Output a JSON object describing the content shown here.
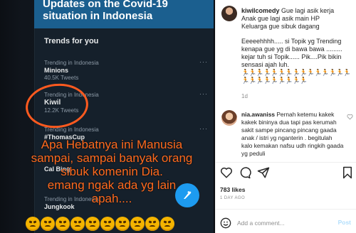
{
  "media": {
    "header_lines": [
      "Updates on the Covid-19",
      "situation in Indonesia"
    ],
    "trends_title": "Trends for you",
    "trends": [
      {
        "context": "Trending in Indonesia",
        "name": "Minions",
        "count": "40.5K Tweets"
      },
      {
        "context": "Trending in Indonesia",
        "name": "Kiwil",
        "count": "12.2K Tweets"
      },
      {
        "context": "Trending in Indonesia",
        "name": "#ThomasCup",
        "count": ""
      },
      {
        "context": "Trending in Indonesia",
        "name": "Cal Bing",
        "count": ""
      },
      {
        "context": "Trending in Indonesia",
        "name": "Jungkook",
        "count": ""
      }
    ],
    "overlay_lines": [
      "Apa Hebatnya ini Manusia",
      "sampai, sampai banyak orang",
      "sibuk komenin Dia.",
      "emang ngak ada yg lain",
      "apah...."
    ],
    "emoji_count": 10,
    "colors": {
      "overlay_text": "#ff6a1e",
      "circle": "#ff5a1f",
      "fab": "#1d9bf0"
    }
  },
  "post": {
    "username": "kiwilcomedy",
    "caption_lines": [
      "Gue lagi asik kerja",
      "Anak gue lagi asik main HP",
      "Keluarga gue sibuk dagang"
    ],
    "caption_body": "Eeeeehhhh..... si Topik yg Trending kenapa gue yg di bawa bawa ......... kejar tuh si Topik...... Pik....Pik bikin sensasi ajah luh.",
    "caption_emoji": "🏃🏃🏃🏃🏃🏃🏃🏃🏃🏃🏃🏃🏃🏃🏃🏃🏃🏃🏃🏃🏃🏃🏃🏃",
    "age": "1d",
    "comment": {
      "username": "nia.awaniss",
      "text": "Pernah ketemu kakek kakek bininya dua tapi pas kerumah sakit sampe pincang pincang gaada anak / istri yg nganterin . begitulah kalo kemakan nafsu udh ringkih gaada yg peduli"
    },
    "likes": "783 likes",
    "date": "1 DAY AGO",
    "add_comment_placeholder": "Add a comment...",
    "post_label": "Post"
  }
}
